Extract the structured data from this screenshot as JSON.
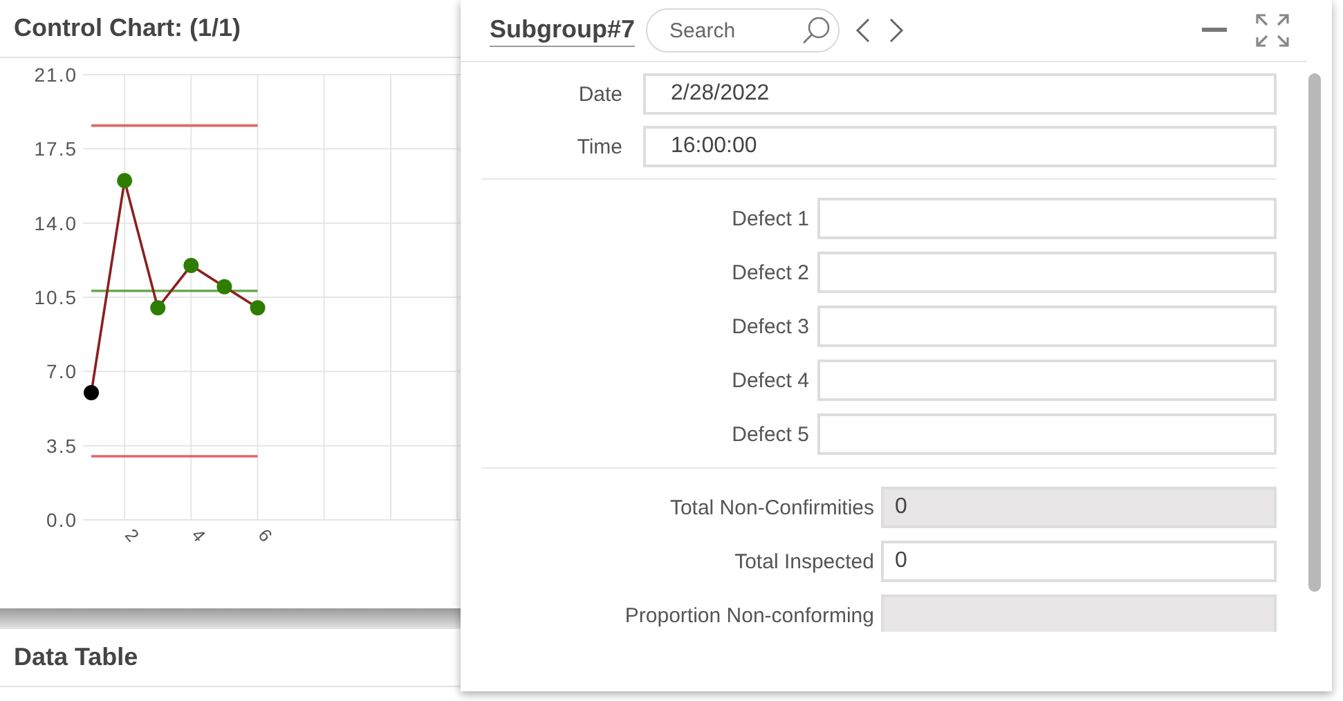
{
  "chart_panel": {
    "title": "Control Chart: (1/1)",
    "chart_data": {
      "type": "line",
      "x": [
        1,
        2,
        3,
        4,
        5,
        6
      ],
      "series": [
        {
          "color": "#e06666",
          "values": [
            18.6,
            18.6,
            18.6,
            18.6,
            18.6,
            18.6
          ]
        },
        {
          "color": "#6aa84f",
          "values": [
            10.8,
            10.8,
            10.8,
            10.8,
            10.8,
            10.8
          ]
        },
        {
          "color": "#e06666",
          "values": [
            3.0,
            3.0,
            3.0,
            3.0,
            3.0,
            3.0
          ]
        },
        {
          "color": "#8b2020",
          "values": [
            6.0,
            16.0,
            10.0,
            12.0,
            11.0,
            10.0
          ]
        },
        {
          "color": "#2e7d00",
          "values": [
            null,
            16.0,
            10.0,
            12.0,
            11.0,
            10.0
          ],
          "marker": "circle",
          "type": "scatter"
        },
        {
          "color": "#000000",
          "values": [
            6.0,
            null,
            null,
            null,
            null,
            null
          ],
          "marker": "circle",
          "type": "scatter"
        }
      ],
      "xlim": [
        0.75,
        12.1
      ],
      "ylim": [
        0,
        21
      ],
      "grid": true,
      "xticks": [
        2,
        4,
        6
      ],
      "yticks": [
        {
          "value": 0,
          "label": "0.0"
        },
        {
          "value": 3.5,
          "label": "3.5"
        },
        {
          "value": 7,
          "label": "7.0"
        },
        {
          "value": 10.5,
          "label": "10.5"
        },
        {
          "value": 14,
          "label": "14.0"
        },
        {
          "value": 17.5,
          "label": "17.5"
        },
        {
          "value": 21,
          "label": "21.0"
        }
      ]
    }
  },
  "data_table": {
    "title": "Data Table"
  },
  "subgroup_dialog": {
    "title": "Subgroup#7",
    "search": {
      "placeholder": "Search"
    },
    "header_fields": [
      {
        "label": "Date",
        "value": "2/28/2022"
      },
      {
        "label": "Time",
        "value": "16:00:00"
      }
    ],
    "defects": [
      {
        "label": "Defect 1"
      },
      {
        "label": "Defect 2"
      },
      {
        "label": "Defect 3"
      },
      {
        "label": "Defect 4"
      },
      {
        "label": "Defect 5"
      }
    ],
    "totals": [
      {
        "label": "Total Non-Confirmities",
        "value": "0",
        "disabled": true
      },
      {
        "label": "Total Inspected",
        "value": "0",
        "disabled": false
      },
      {
        "label": "Proportion Non-conforming",
        "disabled": true
      }
    ]
  }
}
